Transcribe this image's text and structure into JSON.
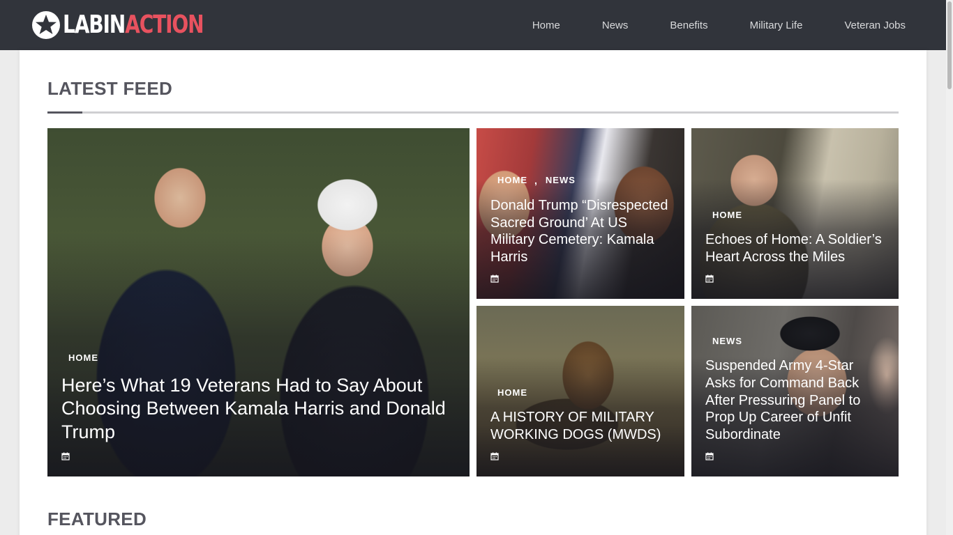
{
  "header": {
    "logo": {
      "part1": "LABIN",
      "part2": "ACTION",
      "icon": "star-icon"
    },
    "nav": [
      {
        "label": "Home"
      },
      {
        "label": "News"
      },
      {
        "label": "Benefits"
      },
      {
        "label": "Military Life"
      },
      {
        "label": "Veteran Jobs"
      }
    ]
  },
  "latest_feed": {
    "title": "LATEST FEED",
    "posts": [
      {
        "categories": [
          "HOME"
        ],
        "title": "Here’s What 19 Veterans Had to Say About Choosing Between Kamala Harris and Donald Trump",
        "date_icon": "calendar-icon"
      },
      {
        "categories": [
          "HOME",
          "NEWS"
        ],
        "category_separator": ",",
        "title": "Donald Trump “Disrespected Sacred Ground’ At US Military Cemetery: Kamala Harris",
        "date_icon": "calendar-icon"
      },
      {
        "categories": [
          "HOME"
        ],
        "title": "Echoes of Home: A Soldier’s Heart Across the Miles",
        "date_icon": "calendar-icon"
      },
      {
        "categories": [
          "HOME"
        ],
        "title": "A HISTORY OF MILITARY WORKING DOGS (MWDS)",
        "date_icon": "calendar-icon"
      },
      {
        "categories": [
          "NEWS"
        ],
        "title": "Suspended Army 4-Star Asks for Command Back After Pressuring Panel to Prop Up Career of Unfit Subordinate",
        "date_icon": "calendar-icon"
      }
    ]
  },
  "featured": {
    "title": "FEATURED"
  },
  "colors": {
    "header_bg": "#31343b",
    "brand_red": "#e8525f",
    "heading": "#55555e"
  }
}
